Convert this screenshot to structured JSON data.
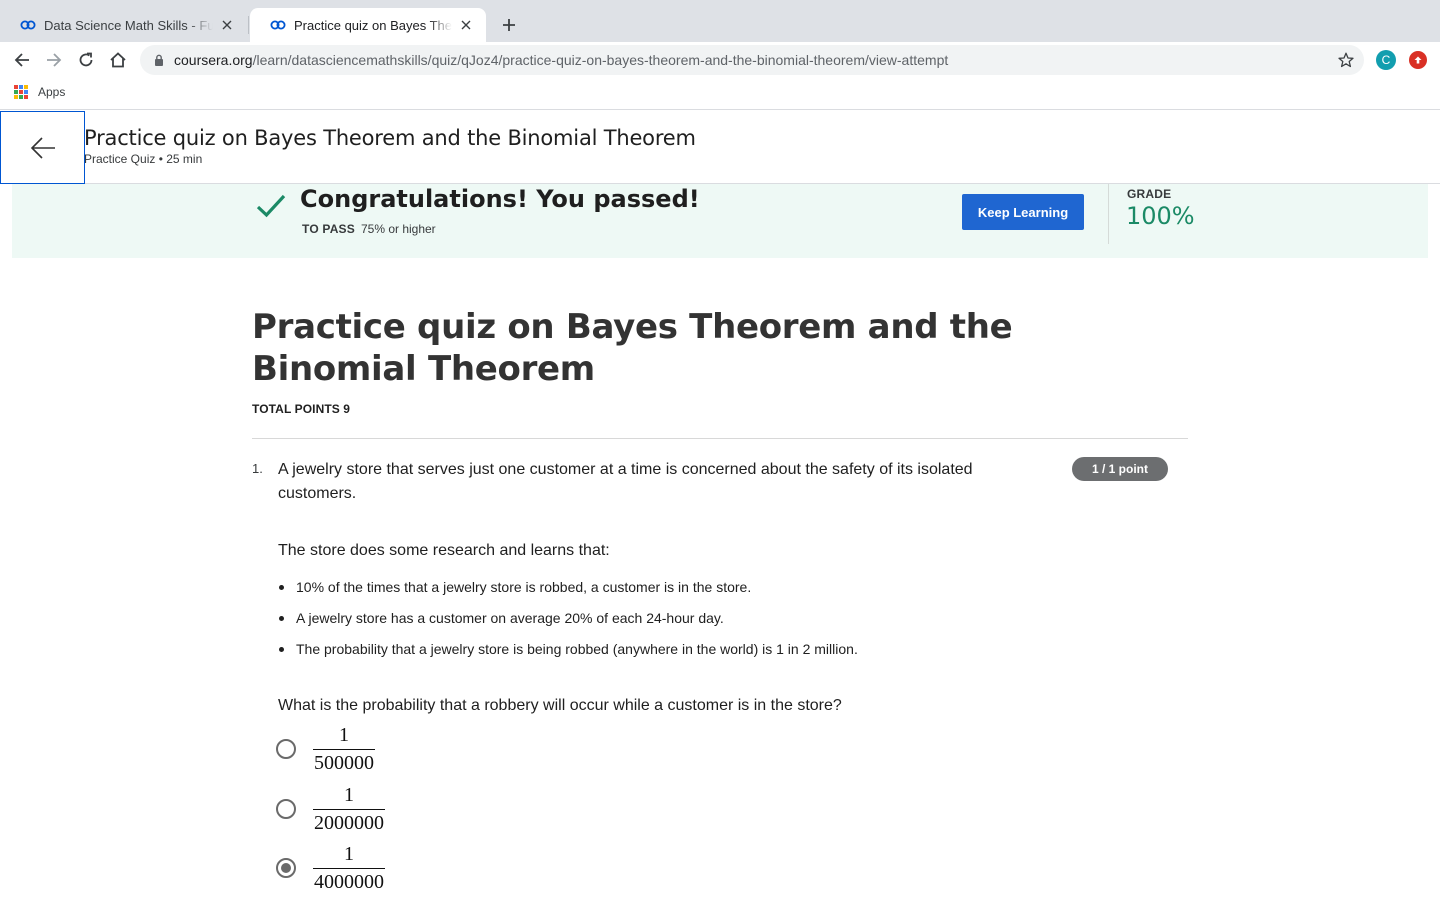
{
  "browser": {
    "tabs": [
      {
        "title": "Data Science Math Skills - Fun",
        "active": false
      },
      {
        "title": "Practice quiz on Bayes Theorem",
        "active": true
      }
    ],
    "url_host": "coursera.org",
    "url_path": "/learn/datasciencemathskills/quiz/qJoz4/practice-quiz-on-bayes-theorem-and-the-binomial-theorem/view-attempt",
    "profile_initial": "C",
    "bookmarks": {
      "apps_label": "Apps"
    }
  },
  "header": {
    "title": "Practice quiz on Bayes Theorem and the Binomial Theorem",
    "subtitle": "Practice Quiz • 25 min"
  },
  "banner": {
    "message": "Congratulations! You passed!",
    "to_pass_label": "TO PASS",
    "to_pass_value": "75% or higher",
    "keep_learning": "Keep Learning",
    "grade_label": "GRADE",
    "grade_value": "100%",
    "accent_color": "#1b8a66"
  },
  "quiz": {
    "title": "Practice quiz on Bayes Theorem and the Binomial Theorem",
    "total_points": "TOTAL POINTS 9",
    "question": {
      "number": "1.",
      "text": "A jewelry store that serves just one customer at a time is concerned about the safety of its isolated customers.",
      "points": "1 / 1 point",
      "intro": "The store does some research and learns that:",
      "facts": [
        "10% of the times that a jewelry store is robbed, a customer is in the store.",
        "A jewelry store has a customer on average 20% of each 24-hour day.",
        "The probability that a jewelry store is being robbed (anywhere in the world) is 1 in 2 million."
      ],
      "ask": "What is the probability that a robbery will occur while a customer is in the store?",
      "options": [
        {
          "numerator": "1",
          "denominator": "500000",
          "selected": false
        },
        {
          "numerator": "1",
          "denominator": "2000000",
          "selected": false
        },
        {
          "numerator": "1",
          "denominator": "4000000",
          "selected": true
        }
      ]
    }
  }
}
